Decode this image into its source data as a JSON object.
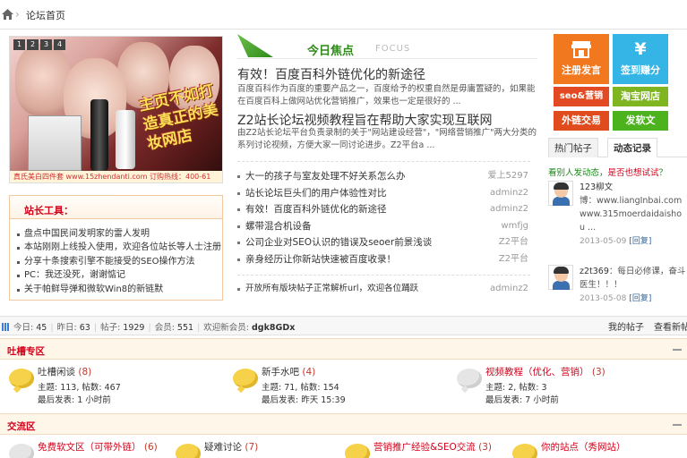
{
  "breadcrumb": {
    "home_icon": "home-icon",
    "current": "论坛首页"
  },
  "slideshow": {
    "pages": [
      "1",
      "2",
      "3",
      "4"
    ],
    "active": 1,
    "brand_text": "主页不如打造真正的美妆网店",
    "strip": "真氏美白四件套 www.15zhendanti.com 订购热线：400-61"
  },
  "tools": {
    "title": "站长工具：",
    "items": [
      "盘点中国民间发明家的雷人发明",
      "本站刚刚上线投入使用，欢迎各位站长等人士注册",
      "分享十条搜索引擎不能接受的SEO操作方法",
      "PC：我还没死，谢谢惦记",
      "关于帕鲜导弹和微软Win8的新链默"
    ]
  },
  "focus": {
    "title": "今日焦点",
    "subtitle": "FOCUS",
    "headline1": "有效！百度百科外链优化的新途径",
    "desc1": "百度百科作为百度的重要产品之一，百度给予的权重自然是毋庸置疑的，如果能在百度百科上做网站优化营销推广，效果也一定是很好的 ...",
    "headline2": "Z2站长论坛视频教程旨在帮助大家实现互联网",
    "desc2": "由Z2站长论坛平台负责录制的关于\"网站建设经营\"，\"网络营销推广\"两大分类的系列讨论视频，方便大家一同讨论进步。Z2平台a ..."
  },
  "news": [
    {
      "title": "大一的孩子与室友处理不好关系怎么办",
      "author": "爱上5297"
    },
    {
      "title": "站长论坛巨头们的用户体验性对比",
      "author": "adminz2"
    },
    {
      "title": "有效！百度百科外链优化的新途径",
      "author": "adminz2"
    },
    {
      "title": "螺带混合机设备",
      "author": "wmfjg"
    },
    {
      "title": "公司企业对SEO认识的错误及seoer前景浅谈",
      "author": "Z2平台"
    },
    {
      "title": "亲身经历让你新站快速被百度收录！",
      "author": "Z2平台"
    }
  ],
  "last_post": {
    "title": "开放所有版块帖子正常解析url，欢迎各位踊跃",
    "author": "adminz2"
  },
  "actions": {
    "post": {
      "label": "注册发言",
      "icon": "store-icon"
    },
    "sign": {
      "label": "签到赚分",
      "icon": "yen-icon"
    },
    "seo": "seo&营销",
    "taobao": "淘宝网店",
    "links": "外链交易",
    "soft": "发软文"
  },
  "tabs": {
    "hot": "热门帖子",
    "activity": "动态记录"
  },
  "activity_note": {
    "prefix": "看别人发动态，",
    "highlight": "是否也想试试",
    "suffix": "？"
  },
  "activities": [
    {
      "user": "123柳文",
      "text": "博：www.liangInbai.com www.315moerdaidaishou ...",
      "time": "2013-05-09",
      "reply": "[回复]"
    },
    {
      "user": "z2t369",
      "text": "：每日必修课，奋斗医生！！！",
      "time": "2013-05-08",
      "reply": "[回复]"
    }
  ],
  "stats": {
    "today_label": "今日:",
    "today": "45",
    "yesterday_label": "昨日:",
    "yesterday": "63",
    "posts_label": "帖子:",
    "posts": "1929",
    "members_label": "会员:",
    "members": "551",
    "welcome_label": "欢迎新会员:",
    "new_member": "dgk8GDx",
    "my_posts": "我的帖子",
    "view_new": "查看新帖"
  },
  "sections": [
    {
      "name": "吐槽专区",
      "forums": [
        {
          "name": "吐槽闲谈",
          "count": "(8)",
          "topics": "主题: 113, 帖数: 467",
          "last": "最后发表: 1 小时前",
          "red": false,
          "gray": false
        },
        {
          "name": "新手水吧",
          "count": "(4)",
          "topics": "主题: 71, 帖数: 154",
          "last": "最后发表: 昨天 15:39",
          "red": false,
          "gray": false
        },
        {
          "name": "视频教程（优化、营销）",
          "count": "(3)",
          "topics": "主题: 2, 帖数: 3",
          "last": "最后发表: 7 小时前",
          "red": true,
          "gray": true
        }
      ]
    },
    {
      "name": "交流区",
      "forums": [
        {
          "name": "免费软文区（可带外链）",
          "count": "(6)",
          "red": true,
          "gray": true
        },
        {
          "name": "疑难讨论",
          "count": "(7)",
          "red": false,
          "gray": false
        },
        {
          "name": "营销推广经验&SEO交流",
          "count": "(3)",
          "red": true,
          "gray": false
        },
        {
          "name": "你的站点（秀网站）",
          "count": "",
          "red": true,
          "gray": false
        }
      ]
    }
  ]
}
